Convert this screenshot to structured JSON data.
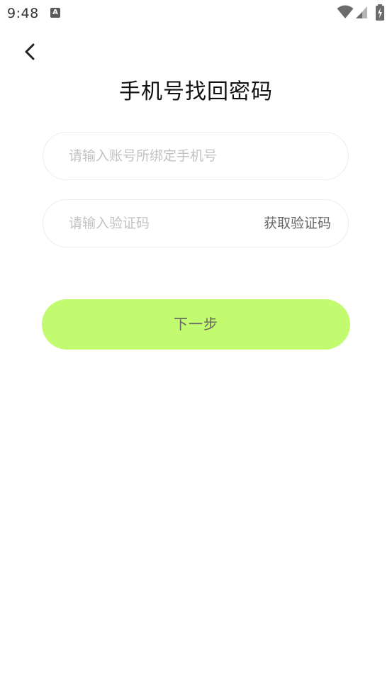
{
  "status_bar": {
    "time": "9:48",
    "notification_icon_letter": "A",
    "icons": [
      "wifi-icon",
      "cell-signal-icon",
      "battery-charging-icon"
    ]
  },
  "header": {
    "back_icon": "chevron-left-icon",
    "title": "手机号找回密码"
  },
  "form": {
    "phone": {
      "placeholder": "请输入账号所绑定手机号",
      "value": ""
    },
    "code": {
      "placeholder": "请输入验证码",
      "value": ""
    },
    "get_code_label": "获取验证码",
    "next_label": "下一步"
  },
  "colors": {
    "primary_button_bg": "#c2fb70",
    "field_border": "#ececec",
    "placeholder": "#c2c2c2"
  }
}
